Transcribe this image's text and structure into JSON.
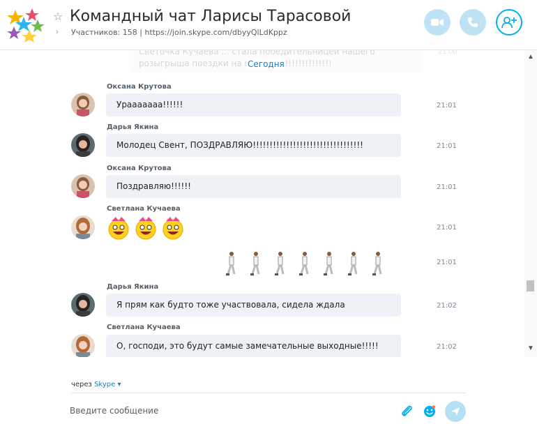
{
  "header": {
    "title": "Командный чат Ларисы Тарасовой",
    "subtitle": "Участников: 158 | https://join.skype.com/dbyyQlLdKppz",
    "favorite_icon": "star-outline-icon",
    "expand_icon": "chevron-right-icon",
    "buttons": [
      "video-call",
      "audio-call",
      "add-participant"
    ]
  },
  "chat": {
    "faded_text": "Светочка Кучаева ... стала победительницей нашего розыгрыша поездки на м... !!!!!!!!!!!!!!!!!!!!!",
    "faded_time": "21:00",
    "divider": "Сегодня",
    "messages": [
      {
        "name": "Оксана Крутова",
        "text": "Урааааааа!!!!!!",
        "time": "21:01"
      },
      {
        "name": "Дарья Якина",
        "text": "Молодец Свент, ПОЗДРАВЛЯЮ!!!!!!!!!!!!!!!!!!!!!!!!!!!!!!!!!",
        "time": "21:01"
      },
      {
        "name": "Оксана Крутова",
        "text": "Поздравляю!!!!!!",
        "time": "21:01"
      },
      {
        "name": "Светлана Кучаева",
        "text": "",
        "time": "21:01"
      },
      {
        "name": "",
        "text": "",
        "time": "21:01"
      },
      {
        "name": "Дарья Якина",
        "text": "Я прям как будто тоже участвовала, сидела ждала",
        "time": "21:02"
      },
      {
        "name": "Светлана Кучаева",
        "text": "О, господи, это будут самые замечательные выходные!!!!!",
        "time": "21:02"
      }
    ]
  },
  "footer": {
    "via_label": "через",
    "via_link": "Skype",
    "input_placeholder": "Введите сообщение"
  },
  "colors": {
    "accent": "#00aff0",
    "link": "#1a7fc2",
    "bubble": "#eef1f5"
  }
}
